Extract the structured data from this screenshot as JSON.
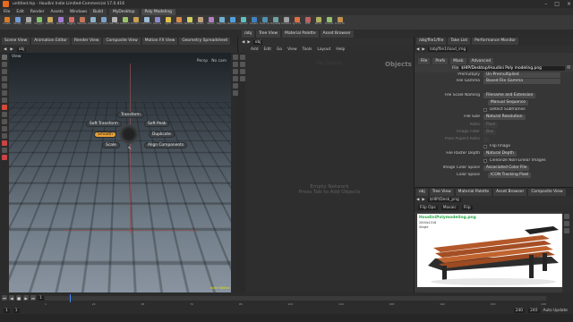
{
  "window": {
    "title": "untitled.hip - Houdini Indie Limited-Commercial 17.0.416",
    "controls": [
      "–",
      "□",
      "×"
    ]
  },
  "menubar": {
    "items": [
      "File",
      "Edit",
      "Render",
      "Assets",
      "Windows",
      "Help"
    ],
    "build_tags": [
      "Build",
      "MyDesktop"
    ],
    "desktop": "Poly Modeling"
  },
  "shelf": {
    "tools": [
      {
        "label": "Create",
        "color": "#d97a2a"
      },
      {
        "label": "Modify",
        "color": "#6e9bd6"
      },
      {
        "label": "Model",
        "color": "#a8a8a8"
      },
      {
        "label": "Polygon",
        "color": "#7ec26a"
      },
      {
        "label": "Deform",
        "color": "#c9a95a"
      },
      {
        "label": "Texture",
        "color": "#a37cd1"
      },
      {
        "label": "Rigging",
        "color": "#d26b6b"
      },
      {
        "label": "Muscles",
        "color": "#c4775a"
      },
      {
        "label": "Characters",
        "color": "#8fb3c9"
      },
      {
        "label": "Constraints",
        "color": "#7aa2c8"
      },
      {
        "label": "Hair Utils",
        "color": "#b4b4b4"
      },
      {
        "label": "Guide Process",
        "color": "#9bc36b"
      },
      {
        "label": "Terrain FX",
        "color": "#c8a050"
      },
      {
        "label": "Cloud FX",
        "color": "#9bbdd8"
      },
      {
        "label": "Volume",
        "color": "#8a8ad0"
      },
      {
        "label": "Lights",
        "color": "#e0c04a"
      },
      {
        "label": "Collisions",
        "color": "#d88a4a"
      },
      {
        "label": "Particles",
        "color": "#d0d060"
      },
      {
        "label": "Grains",
        "color": "#c0a080"
      },
      {
        "label": "Vellum",
        "color": "#b080c0"
      },
      {
        "label": "Rigid Bodies",
        "color": "#70b0d0"
      },
      {
        "label": "Particle Fluids",
        "color": "#50a0e0"
      },
      {
        "label": "Viscous Fluids",
        "color": "#60c0c0"
      },
      {
        "label": "Oceans",
        "color": "#4080c0"
      },
      {
        "label": "Fluid Containers",
        "color": "#5090b0"
      },
      {
        "label": "Populate Containers",
        "color": "#70a0a0"
      },
      {
        "label": "Container Tools",
        "color": "#a0a0a0"
      },
      {
        "label": "Pyro FX",
        "color": "#e07040"
      },
      {
        "label": "FEM",
        "color": "#c06060"
      },
      {
        "label": "Wires",
        "color": "#b0b060"
      },
      {
        "label": "Crowds",
        "color": "#90c070"
      },
      {
        "label": "Drive Simulation",
        "color": "#c09050"
      }
    ]
  },
  "viewport": {
    "tabs": [
      "Scene View",
      "Animation Editor",
      "Render View",
      "Composite View",
      "Motion FX View",
      "Geometry Spreadsheet"
    ],
    "path": "obj",
    "view_label": "View",
    "persp_label": "Persp",
    "cam_label": "No cam",
    "footer_tag": "Indie Edition",
    "radial_menu": {
      "top": "Transform",
      "upper_left": "Soft Transform",
      "upper_right": "Soft Peak",
      "left": "Smooth",
      "right": "Duplicate",
      "lower_left": "Scale",
      "lower_right": "Align Components"
    }
  },
  "network": {
    "tabs": [
      "/obj",
      "Tree View",
      "Material Palette",
      "Asset Browser"
    ],
    "path": "obj",
    "menu": [
      "Add",
      "Edit",
      "Go",
      "View",
      "Tools",
      "Layout",
      "Help"
    ],
    "context_label": "Objects",
    "hint_top": "Obj Objects",
    "hint_line1": "Empty Network",
    "hint_line2": "Press Tab to Add Objects"
  },
  "parameters": {
    "tabs": [
      "/obj/file1/file",
      "Take List",
      "Performance Monitor"
    ],
    "path": "/obj/file1/load_img",
    "subtabs": [
      "File",
      "Prefs",
      "Mask",
      "Advanced"
    ],
    "file_label": "File",
    "file_value": "$HIP/Desktop/Houdini Poly modeling.png",
    "rows": [
      {
        "label": "Premultiply",
        "value": "Un-Premultiplied"
      },
      {
        "label": "File Gamma",
        "value": "Based File Gamma"
      },
      {
        "label": "File Scale Naming",
        "value": "Filename and Extension"
      },
      {
        "label": "",
        "value": "Manual Sequence"
      },
      {
        "label": "",
        "value": "Detect Subframes"
      },
      {
        "label": "File Size",
        "value": "Natural Resolution"
      },
      {
        "label": "Ratio",
        "value": "Pixel"
      },
      {
        "label": "Image Filter",
        "value": "Box"
      },
      {
        "label": "Pixel Aspect Ratio",
        "value": ""
      },
      {
        "label": "",
        "value": "Flip Image"
      },
      {
        "label": "File Raster Depth",
        "value": "Natural Depth"
      },
      {
        "label": "",
        "value": "Linearize Non-Linear Images"
      },
      {
        "label": "Image Color Space",
        "value": "Associated Color File"
      },
      {
        "label": "Color Space",
        "value": "ICON Tracking Pixel"
      }
    ]
  },
  "image_viewer": {
    "tabs": [
      "obj",
      "Tree View",
      "Material Palette",
      "Asset Browser",
      "Composite View"
    ],
    "path": "$HIP/Desk_png",
    "toolbar": [
      "Flip Ops",
      "Mosaic",
      "Flip"
    ],
    "image_name": "HoudiniPolymodeling.png",
    "resolution": "2000x1316",
    "type": "Single"
  },
  "timeline": {
    "frames": [
      "1",
      "24",
      "48",
      "72",
      "96",
      "120",
      "144",
      "168",
      "192",
      "216",
      "240"
    ],
    "start": "1",
    "end": "240",
    "current": "1",
    "fps_label": "Auto Update"
  }
}
